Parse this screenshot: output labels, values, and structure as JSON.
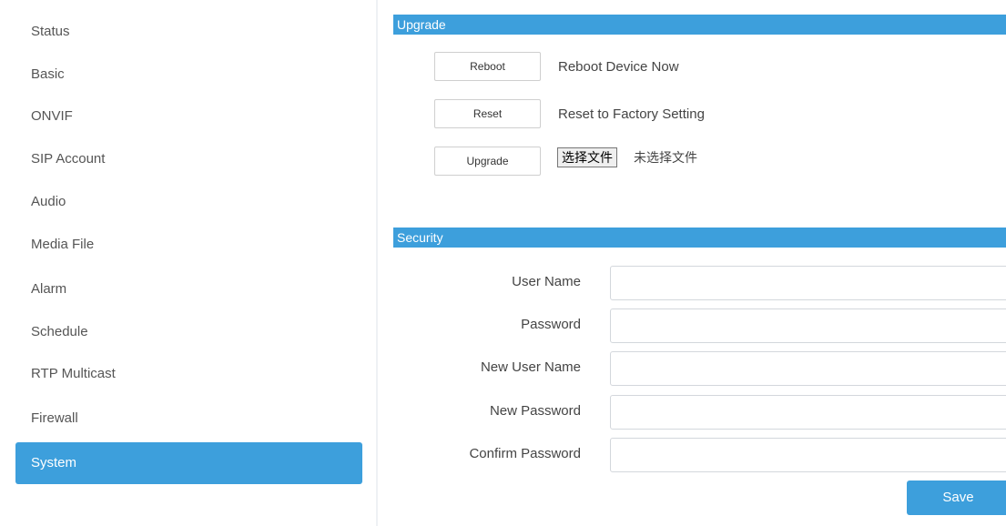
{
  "sidebar": {
    "items": [
      {
        "label": "Status"
      },
      {
        "label": "Basic"
      },
      {
        "label": "ONVIF"
      },
      {
        "label": "SIP Account"
      },
      {
        "label": "Audio"
      },
      {
        "label": "Media File"
      },
      {
        "label": "Alarm"
      },
      {
        "label": "Schedule"
      },
      {
        "label": "RTP Multicast"
      },
      {
        "label": "Firewall"
      },
      {
        "label": "System",
        "active": true
      }
    ]
  },
  "upgrade": {
    "title": "Upgrade",
    "reboot_button": "Reboot",
    "reboot_desc": "Reboot Device Now",
    "reset_button": "Reset",
    "reset_desc": "Reset to Factory Setting",
    "upgrade_button": "Upgrade",
    "choose_file_button": "选择文件",
    "file_status": "未选择文件"
  },
  "security": {
    "title": "Security",
    "fields": [
      {
        "label": "User Name",
        "value": ""
      },
      {
        "label": "Password",
        "value": ""
      },
      {
        "label": "New User Name",
        "value": ""
      },
      {
        "label": "New Password",
        "value": ""
      },
      {
        "label": "Confirm Password",
        "value": ""
      }
    ],
    "save_button": "Save"
  },
  "colors": {
    "accent": "#3d9fdc"
  }
}
